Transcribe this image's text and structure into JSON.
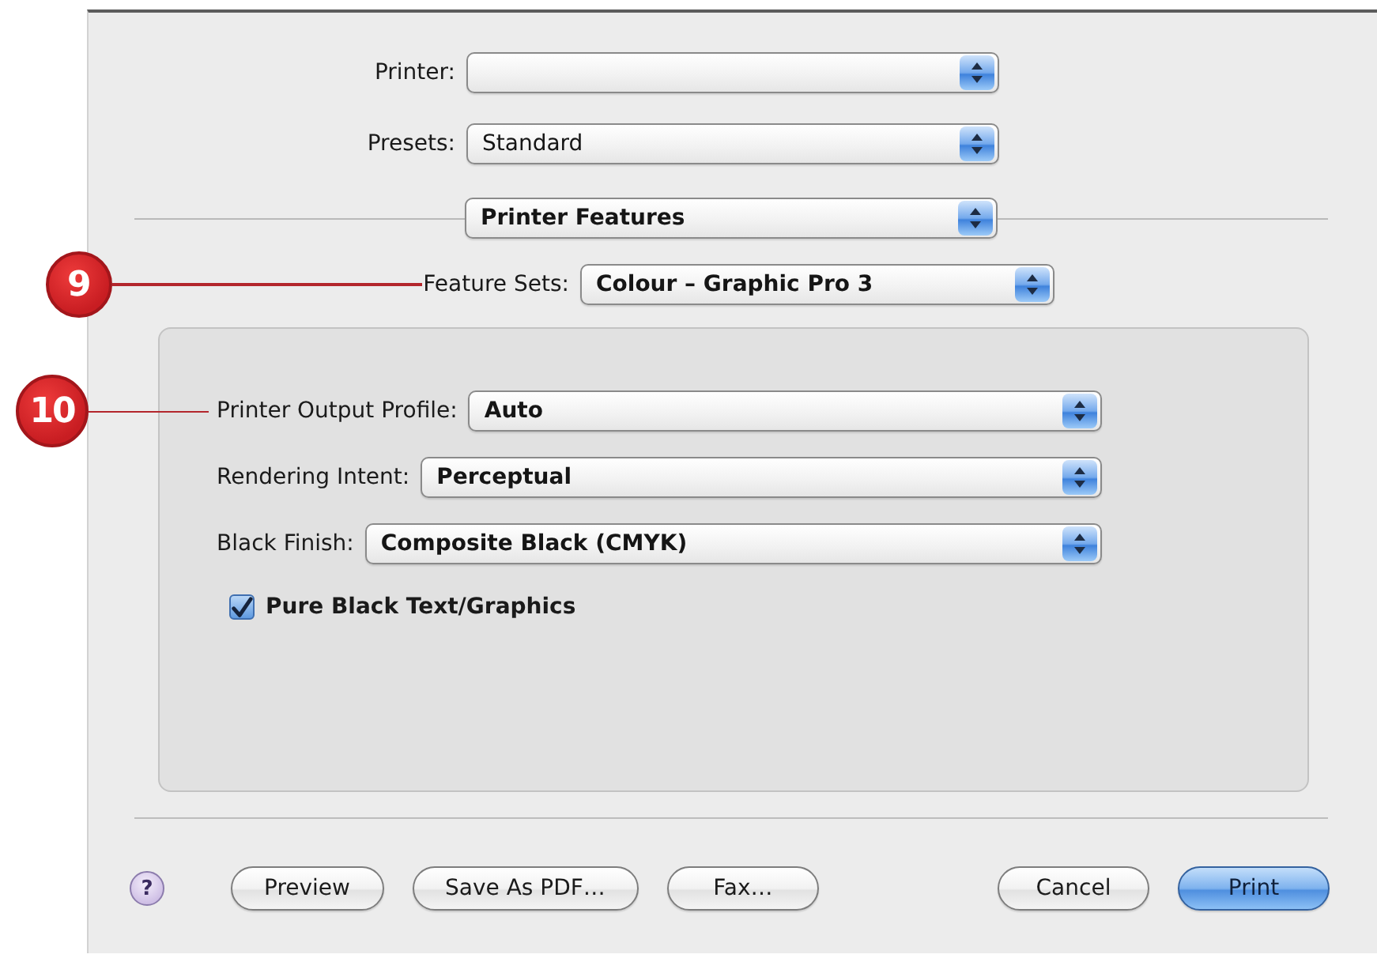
{
  "print_settings": [
    {
      "label": "Printer:"
    },
    {
      "label": "Presets:",
      "value": "Standard"
    }
  ],
  "pane_menu": {
    "value": "Printer Features"
  },
  "feature_sets": {
    "label": "Feature Sets:",
    "value": "Colour – Graphic Pro 3",
    "callout": "9"
  },
  "feature_panel": {
    "options": [
      {
        "kind": "popup",
        "label": "Printer Output Profile:",
        "value": "Auto",
        "callout": "10"
      },
      {
        "kind": "popup",
        "label": "Rendering Intent:",
        "value": "Perceptual"
      },
      {
        "kind": "popup",
        "label": "Black Finish:",
        "value": "Composite Black (CMYK)"
      },
      {
        "kind": "checkbox",
        "label": "Pure Black Text/Graphics",
        "checked": true
      }
    ]
  },
  "help_button": {
    "label": "?"
  },
  "left_buttons": [
    {
      "label": "Preview",
      "default": false
    },
    {
      "label": "Save As PDF…",
      "default": false
    },
    {
      "label": "Fax…",
      "default": false
    }
  ],
  "right_buttons": [
    {
      "label": "Cancel",
      "default": false
    },
    {
      "label": "Print",
      "default": true
    }
  ]
}
